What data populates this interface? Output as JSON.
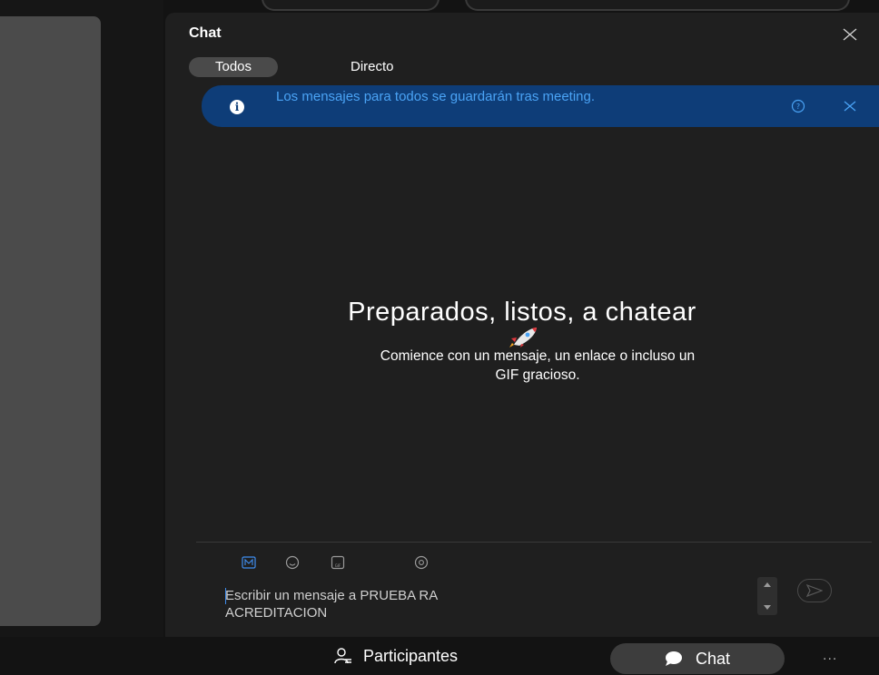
{
  "chat_panel": {
    "title": "Chat",
    "tabs": [
      {
        "label": "Todos",
        "active": true
      },
      {
        "label": "Directo",
        "active": false
      }
    ],
    "banner": {
      "text": "Los mensajes para todos se guardarán tras meeting."
    },
    "empty_state": {
      "title": "Preparados, listos, a chatear",
      "subtitle_line1": "Comience con un mensaje, un enlace o incluso un",
      "subtitle_line2": "GIF gracioso."
    },
    "composer": {
      "placeholder_line1": "Escribir un mensaje a PRUEBA RA",
      "placeholder_line2": "ACREDITACION"
    },
    "toolbar_icons": [
      "markdown-icon",
      "emoji-icon",
      "gif-icon",
      "mention-icon"
    ]
  },
  "bottom_bar": {
    "participants_label": "Participantes",
    "chat_label": "Chat",
    "more_label": "..."
  },
  "colors": {
    "background": "#131313",
    "panel": "#1f1f1f",
    "banner_bg": "#0e3d78",
    "banner_text": "#4aa3f5",
    "accent": "#3f8ef0"
  }
}
